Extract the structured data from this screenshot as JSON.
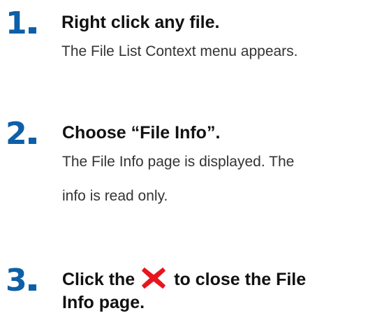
{
  "steps": [
    {
      "number": "1",
      "title": "Right click any file.",
      "description_line1": "The File List Context menu appears.",
      "description_line2": ""
    },
    {
      "number": "2",
      "title": "Choose “File Info”.",
      "description_line1": "The File Info page is displayed. The",
      "description_line2": "info is read only."
    },
    {
      "number": "3",
      "title_before_icon": "Click the",
      "title_after_icon": "to close the File",
      "title_line2": "Info page.",
      "icon": "close-x-icon",
      "icon_color": "#e8141e"
    }
  ],
  "colors": {
    "step_number": "#0d5fa8",
    "title": "#111111",
    "description": "#333333"
  }
}
